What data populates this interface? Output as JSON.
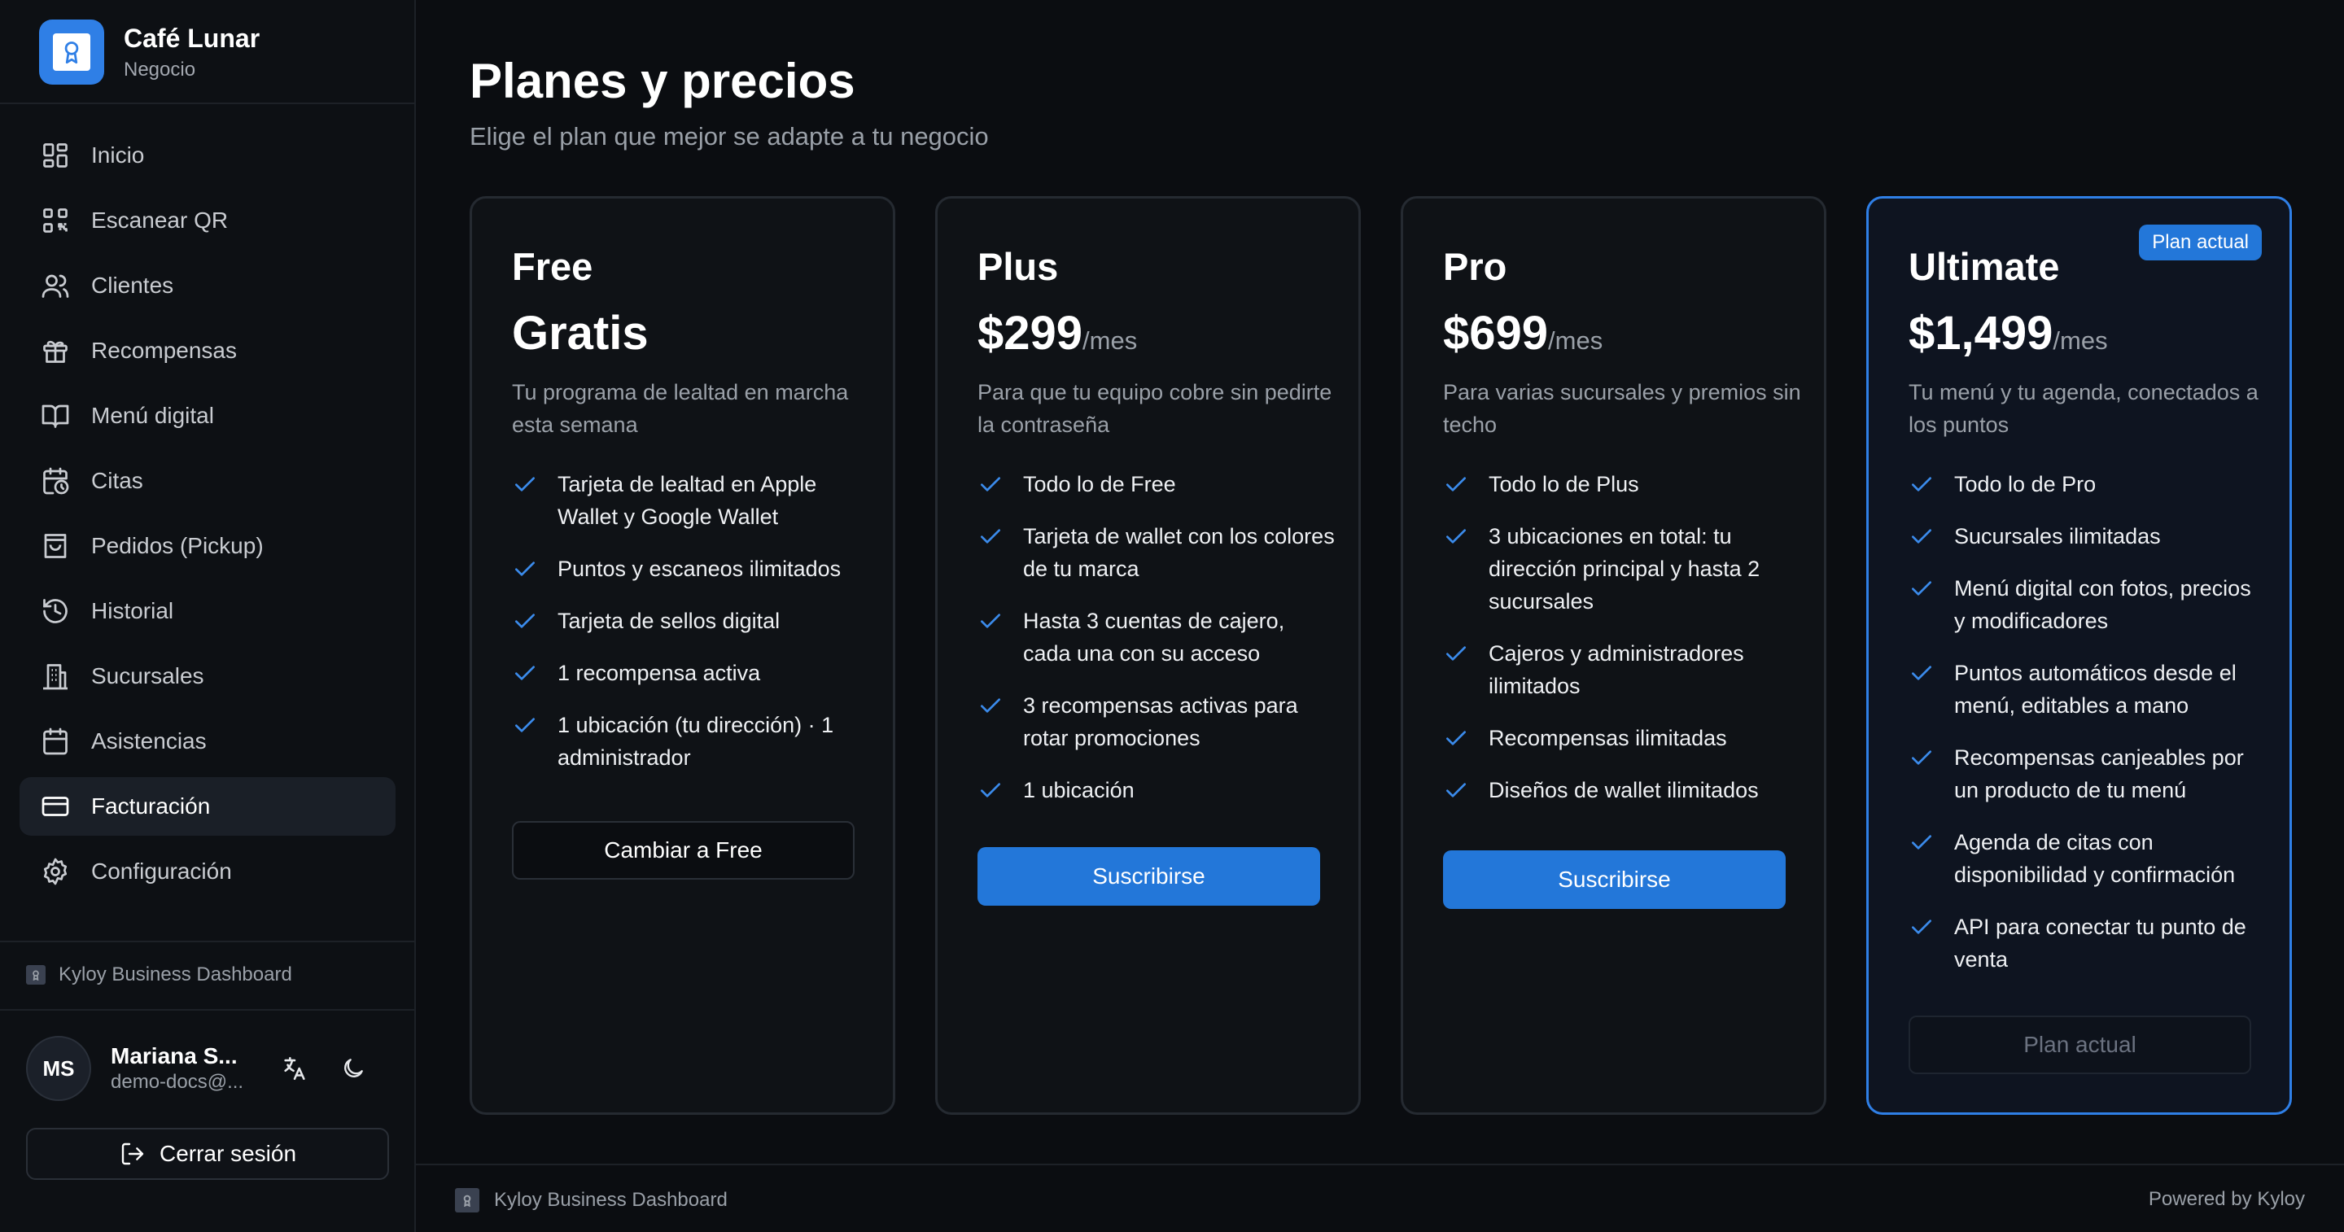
{
  "app": {
    "name": "Café Lunar",
    "subtitle": "Negocio"
  },
  "sidebar": {
    "items": [
      {
        "label": "Inicio",
        "icon": "grid-icon"
      },
      {
        "label": "Escanear QR",
        "icon": "qr-code-icon"
      },
      {
        "label": "Clientes",
        "icon": "users-icon"
      },
      {
        "label": "Recompensas",
        "icon": "gift-icon"
      },
      {
        "label": "Menú digital",
        "icon": "book-open-icon"
      },
      {
        "label": "Citas",
        "icon": "calendar-clock-icon"
      },
      {
        "label": "Pedidos (Pickup)",
        "icon": "shopping-bag-icon"
      },
      {
        "label": "Historial",
        "icon": "history-icon"
      },
      {
        "label": "Sucursales",
        "icon": "building-icon"
      },
      {
        "label": "Asistencias",
        "icon": "calendar-icon"
      },
      {
        "label": "Facturación",
        "icon": "credit-card-icon",
        "active": true
      },
      {
        "label": "Configuración",
        "icon": "gear-icon"
      }
    ],
    "footer_brand": "Kyloy Business Dashboard",
    "user": {
      "initials": "MS",
      "name": "Mariana S...",
      "email": "demo-docs@..."
    },
    "logout_label": "Cerrar sesión"
  },
  "main": {
    "title": "Planes y precios",
    "subtitle": "Elige el plan que mejor se adapte a tu negocio",
    "plans": [
      {
        "name": "Free",
        "price": "Gratis",
        "unit": "",
        "description": "Tu programa de lealtad en marcha esta semana",
        "features": [
          "Tarjeta de lealtad en Apple Wallet y Google Wallet",
          "Puntos y escaneos ilimitados",
          "Tarjeta de sellos digital",
          "1 recompensa activa",
          "1 ubicación (tu dirección) · 1 administrador"
        ],
        "button": "Cambiar a Free"
      },
      {
        "name": "Plus",
        "price": "$299",
        "unit": "/mes",
        "description": "Para que tu equipo cobre sin pedirte la contraseña",
        "features": [
          "Todo lo de Free",
          "Tarjeta de wallet con los colores de tu marca",
          "Hasta 3 cuentas de cajero, cada una con su acceso",
          "3 recompensas activas para rotar promociones",
          "1 ubicación"
        ],
        "button": "Suscribirse"
      },
      {
        "name": "Pro",
        "price": "$699",
        "unit": "/mes",
        "description": "Para varias sucursales y premios sin techo",
        "features": [
          "Todo lo de Plus",
          "3 ubicaciones en total: tu dirección principal y hasta 2 sucursales",
          "Cajeros y administradores ilimitados",
          "Recompensas ilimitadas",
          "Diseños de wallet ilimitados"
        ],
        "button": "Suscribirse"
      },
      {
        "name": "Ultimate",
        "price": "$1,499",
        "unit": "/mes",
        "badge": "Plan actual",
        "description": "Tu menú y tu agenda, conectados a los puntos",
        "features": [
          "Todo lo de Pro",
          "Sucursales ilimitadas",
          "Menú digital con fotos, precios y modificadores",
          "Puntos automáticos desde el menú, editables a mano",
          "Recompensas canjeables por un producto de tu menú",
          "Agenda de citas con disponibilidad y confirmación",
          "API para conectar tu punto de venta"
        ],
        "button": "Plan actual"
      }
    ]
  },
  "footer": {
    "brand": "Kyloy Business Dashboard",
    "powered": "Powered by Kyloy"
  },
  "colors": {
    "accent": "#2377d9",
    "background": "#0b0d11",
    "card_border": "#252a31"
  }
}
